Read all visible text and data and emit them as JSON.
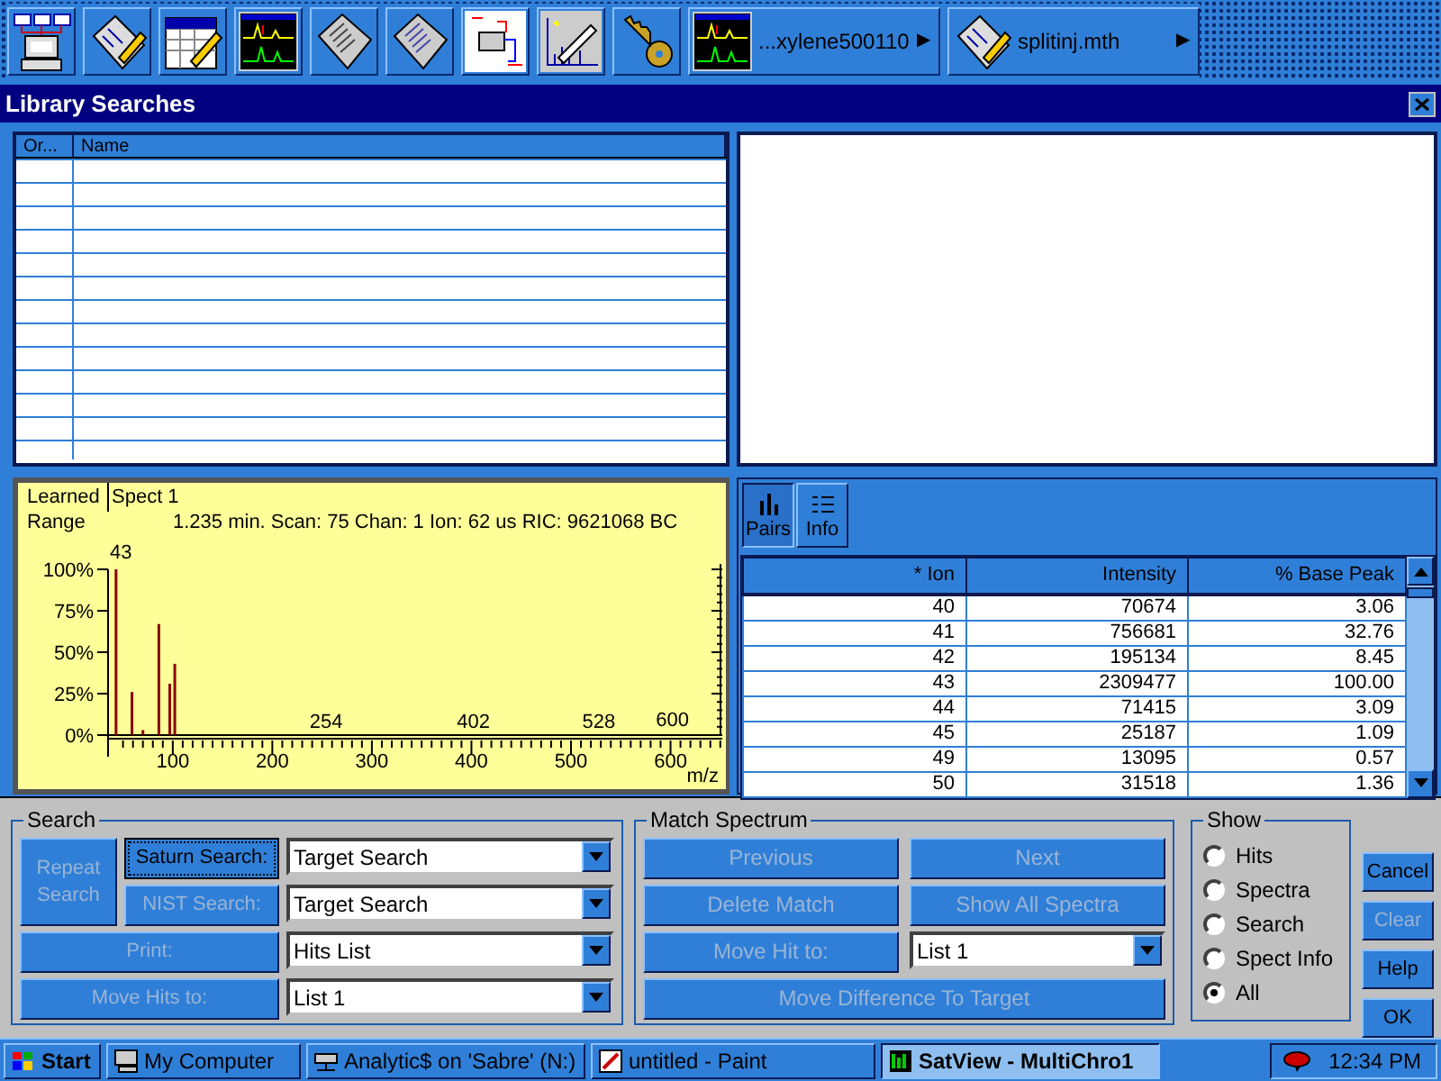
{
  "toolbar": {
    "files": [
      {
        "label": "...xylene500110",
        "arrow": "▶"
      },
      {
        "label": "splitinj.mth",
        "arrow": "▶"
      }
    ]
  },
  "window": {
    "title": "Library Searches"
  },
  "library_table": {
    "columns": [
      "Or...",
      "Name"
    ]
  },
  "spectrum": {
    "labels": [
      "Learned",
      "Range"
    ],
    "spectrum_title": "Spect 1",
    "scan_info": "1.235 min. Scan: 75 Chan: 1 Ion: 62 us RIC: 9621068 BC",
    "peak_labels": [
      "43",
      "254",
      "402",
      "528",
      "600"
    ],
    "chart_data": {
      "type": "bar",
      "xlabel": "m/z",
      "x": [
        43,
        59,
        70,
        86,
        97,
        102
      ],
      "values": [
        100,
        26,
        3,
        67,
        31,
        43
      ],
      "xlim": [
        35,
        652
      ],
      "ylim": [
        0,
        100
      ],
      "xticks": [
        100,
        200,
        300,
        400,
        500,
        600
      ],
      "yticks": [
        {
          "value": 0,
          "label": "0%"
        },
        {
          "value": 25,
          "label": "25%"
        },
        {
          "value": 50,
          "label": "50%"
        },
        {
          "value": 75,
          "label": "75%"
        },
        {
          "value": 100,
          "label": "100%"
        }
      ]
    }
  },
  "ion_view": {
    "tabs": [
      {
        "label": "Pairs",
        "selected": true
      },
      {
        "label": "Info",
        "selected": false
      }
    ],
    "table": {
      "columns": [
        "* Ion",
        "Intensity",
        "% Base Peak"
      ],
      "rows": [
        [
          "40",
          "70674",
          "3.06"
        ],
        [
          "41",
          "756681",
          "32.76"
        ],
        [
          "42",
          "195134",
          "8.45"
        ],
        [
          "43",
          "2309477",
          "100.00"
        ],
        [
          "44",
          "71415",
          "3.09"
        ],
        [
          "45",
          "25187",
          "1.09"
        ],
        [
          "49",
          "13095",
          "0.57"
        ],
        [
          "50",
          "31518",
          "1.36"
        ]
      ]
    }
  },
  "search": {
    "title": "Search",
    "buttons": [
      {
        "label": "Repeat Search",
        "disabled": true,
        "focused": false
      },
      {
        "label": "Saturn Search:",
        "disabled": false,
        "focused": true
      },
      {
        "label": "NIST Search:",
        "disabled": true,
        "focused": false
      },
      {
        "label": "Print:",
        "disabled": true,
        "focused": false
      },
      {
        "label": "Move Hits to:",
        "disabled": true,
        "focused": false
      }
    ],
    "dropdowns": [
      "Target Search",
      "Target Search",
      "Hits List",
      "List 1"
    ]
  },
  "match_spectrum": {
    "title": "Match Spectrum",
    "buttons": [
      {
        "label": "Previous",
        "disabled": true
      },
      {
        "label": "Next",
        "disabled": true
      },
      {
        "label": "Delete Match",
        "disabled": true
      },
      {
        "label": "Show All Spectra",
        "disabled": true
      },
      {
        "label": "Move Hit to:",
        "disabled": true
      },
      {
        "label": "Move Difference To Target",
        "disabled": true
      }
    ],
    "dropdown": "List 1"
  },
  "show": {
    "title": "Show",
    "options": [
      {
        "label": "Hits",
        "selected": false
      },
      {
        "label": "Spectra",
        "selected": false
      },
      {
        "label": "Search",
        "selected": false
      },
      {
        "label": "Spect Info",
        "selected": false
      },
      {
        "label": "All",
        "selected": true
      }
    ]
  },
  "dialog_buttons": [
    {
      "label": "Cancel",
      "disabled": false
    },
    {
      "label": "Clear",
      "disabled": true
    },
    {
      "label": "Help",
      "disabled": false
    },
    {
      "label": "OK",
      "disabled": false
    }
  ],
  "taskbar": {
    "start": "Start",
    "tasks": [
      {
        "label": "My Computer",
        "selected": false
      },
      {
        "label": "Analytic$ on 'Sabre' (N:)",
        "selected": false
      },
      {
        "label": "untitled - Paint",
        "selected": false
      },
      {
        "label": "SatView - MultiChro1",
        "selected": true
      }
    ],
    "clock": "12:34 PM"
  }
}
